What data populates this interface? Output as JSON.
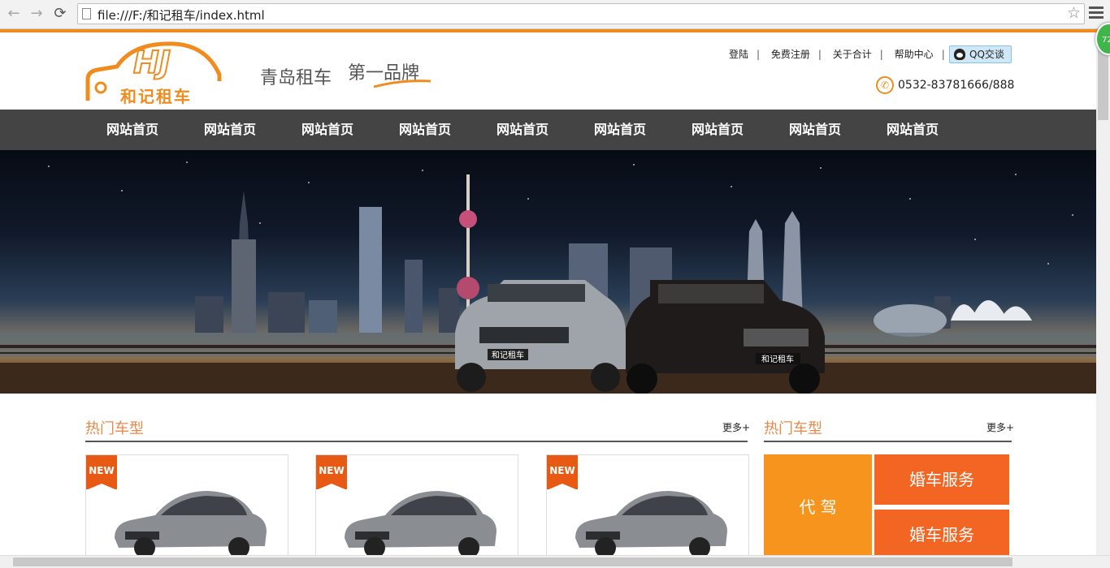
{
  "browser": {
    "url": "file:///F:/和记租车/index.html",
    "badge": "72"
  },
  "header": {
    "logo_letters": "HJ",
    "logo_name": "和记租车",
    "slogan_left": "青岛租车",
    "slogan_right": "第一品牌",
    "links": [
      "登陆",
      "免费注册",
      "关于合计",
      "帮助中心"
    ],
    "qq_label": "QQ交谈",
    "phone": "0532-83781666/888"
  },
  "nav": {
    "items": [
      "网站首页",
      "网站首页",
      "网站首页",
      "网站首页",
      "网站首页",
      "网站首页",
      "网站首页",
      "网站首页",
      "网站首页"
    ]
  },
  "banner": {
    "plate_1": "和记租车",
    "plate_2": "和记租车"
  },
  "hot_cars": {
    "title": "热门车型",
    "more": "更多+",
    "cards": [
      {
        "tag": "NEW"
      },
      {
        "tag": "NEW"
      },
      {
        "tag": "NEW"
      }
    ]
  },
  "services": {
    "title": "热门车型",
    "more": "更多+",
    "driver": "代 驾",
    "wedding_1": "婚车服务",
    "wedding_2": "婚车服务",
    "colors": {
      "orange": "#f7941d",
      "red_orange": "#f26522"
    }
  }
}
